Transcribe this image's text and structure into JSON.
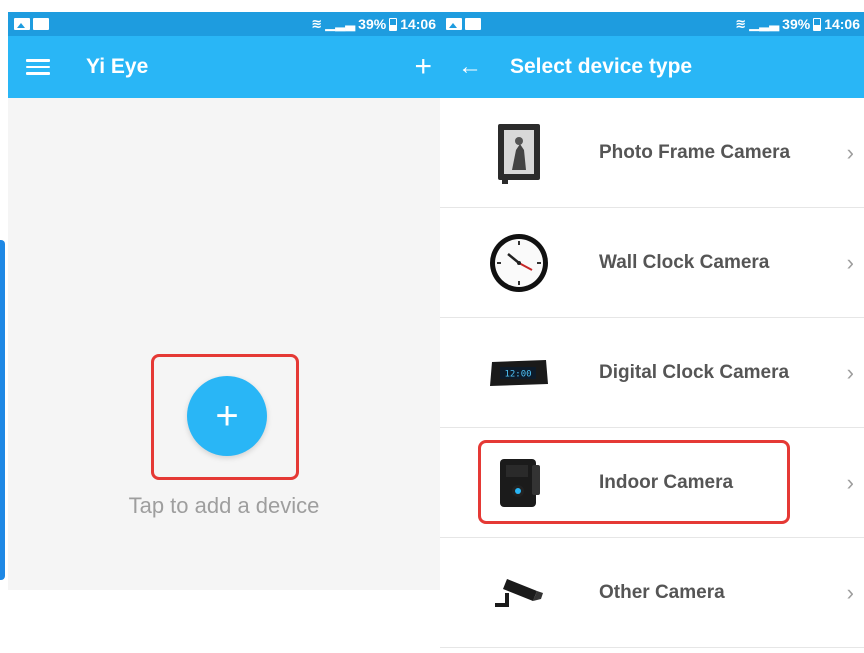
{
  "left_screen": {
    "status": {
      "battery": "39%",
      "time": "14:06"
    },
    "app_bar": {
      "title": "Yi Eye"
    },
    "empty_state": {
      "hint": "Tap to add a device",
      "fab_symbol": "+"
    }
  },
  "right_screen": {
    "status": {
      "battery": "39%",
      "time": "14:06"
    },
    "app_bar": {
      "title": "Select device type"
    },
    "devices": [
      {
        "label": "Photo Frame Camera",
        "icon": "photo-frame-camera-icon"
      },
      {
        "label": "Wall Clock Camera",
        "icon": "wall-clock-camera-icon"
      },
      {
        "label": "Digital Clock Camera",
        "icon": "digital-clock-camera-icon"
      },
      {
        "label": "Indoor Camera",
        "icon": "indoor-camera-icon"
      },
      {
        "label": "Other Camera",
        "icon": "other-camera-icon"
      }
    ],
    "digital_clock_display": "12:00"
  },
  "colors": {
    "status_bar": "#1e9cdf",
    "app_bar": "#29b6f6",
    "highlight": "#e53935",
    "fab": "#29b6f6"
  }
}
